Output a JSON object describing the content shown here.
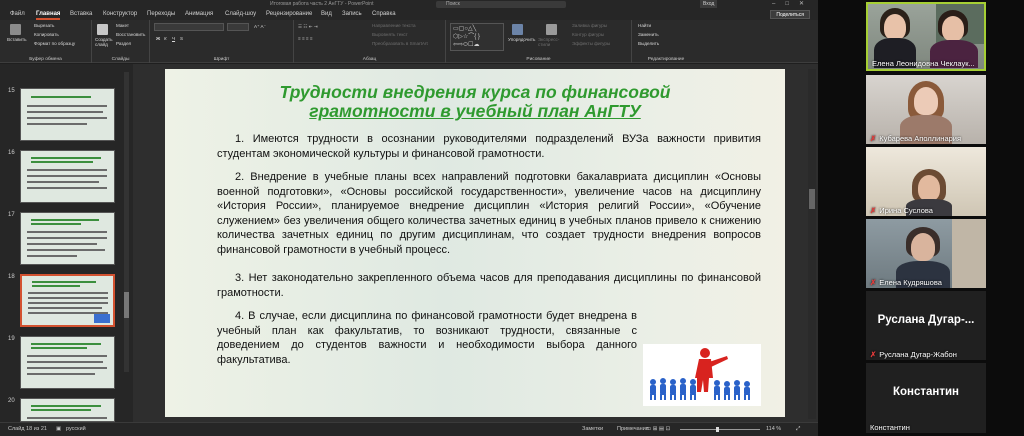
{
  "window": {
    "title": "Итоговая работа часть 2 АнГТУ - PowerPoint",
    "search": "Поиск",
    "login": "Вход",
    "share_label": "Поделиться"
  },
  "tabs": [
    "Файл",
    "Главная",
    "Вставка",
    "Конструктор",
    "Переходы",
    "Анимация",
    "Слайд-шоу",
    "Рецензирование",
    "Вид",
    "Запись",
    "Справка"
  ],
  "ribbon": {
    "clipboard": {
      "paste": "Вставить",
      "cut": "Вырезать",
      "copy": "Копировать",
      "format": "Формат по образцу",
      "label": "Буфер обмена"
    },
    "slides": {
      "new": "Создать слайд",
      "layout": "Макет",
      "reset": "Восстановить",
      "section": "Раздел",
      "label": "Слайды"
    },
    "font": {
      "label": "Шрифт"
    },
    "paragraph": {
      "dir": "Направление текста",
      "align": "Выровнять текст",
      "smartart": "Преобразовать в SmartArt",
      "label": "Абзац"
    },
    "drawing": {
      "arrange": "Упорядочить",
      "styles": "Экспресс-стили",
      "fill": "Заливка фигуры",
      "outline": "Контур фигуры",
      "effects": "Эффекты фигуры",
      "label": "Рисование"
    },
    "editing": {
      "find": "Найти",
      "replace": "Заменить",
      "select": "Выделить",
      "label": "Редактирование"
    }
  },
  "thumbnails": [
    {
      "num": "15"
    },
    {
      "num": "16"
    },
    {
      "num": "17"
    },
    {
      "num": "18"
    },
    {
      "num": "19"
    },
    {
      "num": "20"
    }
  ],
  "slide": {
    "title_line1": "Трудности внедрения курса по финансовой",
    "title_line2": "грамотности в учебный план АнГТУ",
    "p1": "1. Имеются трудности в осознании руководителями подразделений ВУЗа важности привития студентам экономической культуры и финансовой грамотности.",
    "p2": "2. Внедрение в учебные планы всех направлений подготовки бакалавриата дисциплин «Основы военной подготовки», «Основы российской государственности», увеличение часов на дисциплину «История России», планируемое внедрение дисциплин «История религий России», «Обучение служением» без увеличения общего количества зачетных единиц в учебных планов привело к снижению количества зачетных единиц по другим дисциплинам, что создает трудности внедрения вопросов финансовой грамотности в учебный процесс.",
    "p3": "3. Нет законодательно закрепленного объема часов для преподавания дисциплины по финансовой грамотности.",
    "p4": "4. В случае, если дисциплина по финансовой грамотности будет внедрена в учебный план как факультатив, то возникают трудности, связанные с доведением до студентов важности и необходимости выбора данного факультатива."
  },
  "status": {
    "slide_info": "Слайд 18 из 21",
    "language": "русский",
    "notes": "Заметки",
    "comments": "Примечания",
    "zoom": "114 %"
  },
  "participants": [
    {
      "name": "Елена Леонидовна Чеклаук...",
      "muted": false
    },
    {
      "name": "Кубарева Аполлинария",
      "muted": true
    },
    {
      "name": "Ирина Суслова",
      "muted": true
    },
    {
      "name": "Елена Кудряшова",
      "muted": true
    },
    {
      "name": "Руслана Дугар-Жабон",
      "display": "Руслана Дугар-...",
      "muted": true
    },
    {
      "name": "Константин",
      "display": "Константин",
      "muted": false
    }
  ],
  "colors": {
    "accent": "#d35230",
    "active_speaker": "#a6cf34",
    "title_green": "#2f9a2f",
    "mic_muted": "#e23c3c"
  }
}
